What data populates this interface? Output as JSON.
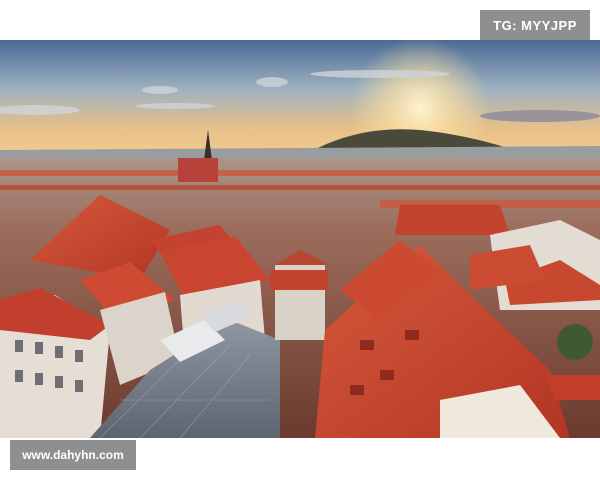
{
  "watermarks": {
    "top_right": "TG: MYYJPP",
    "bottom_left": "www.dahyhn.com"
  },
  "colors": {
    "badge_bg": "#8f8f8f",
    "badge_text": "#ffffff",
    "roof_red": "#c0412c",
    "sky_dusk": "#d9a877",
    "sky_top": "#4a6b96"
  }
}
